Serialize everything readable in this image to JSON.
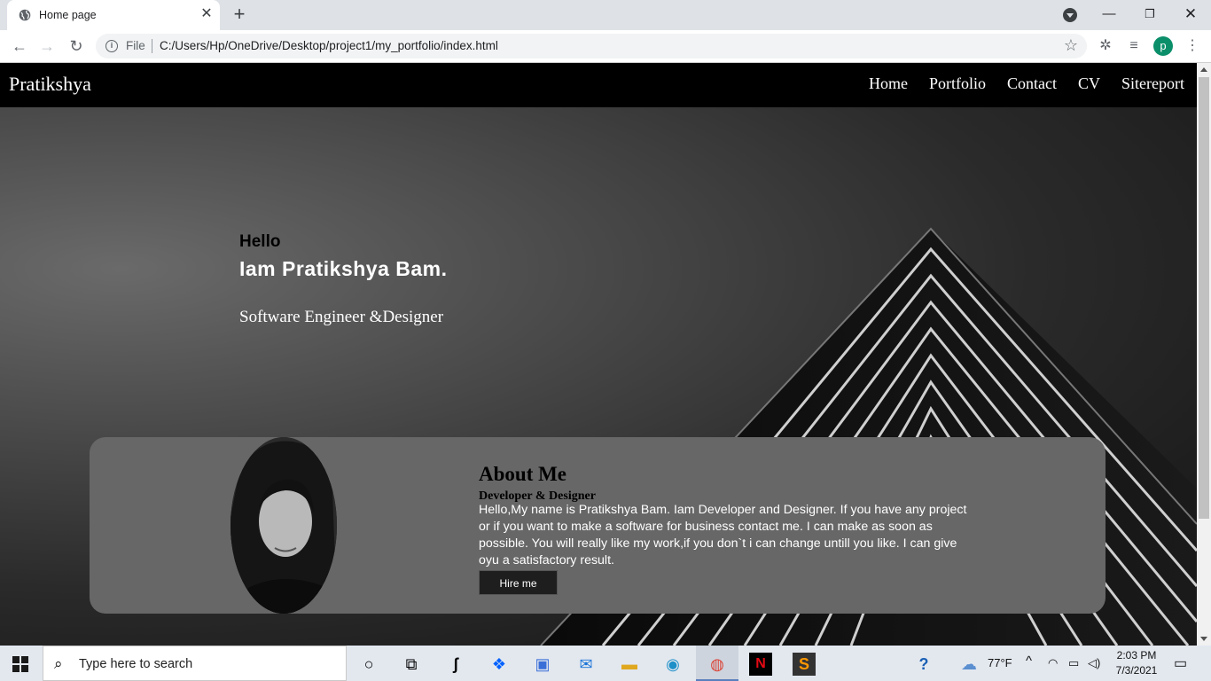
{
  "browser": {
    "tab_title": "Home page",
    "scheme_label": "File",
    "url": "C:/Users/Hp/OneDrive/Desktop/project1/my_portfolio/index.html",
    "profile_initial": "p"
  },
  "site": {
    "brand": "Pratikshya",
    "nav": [
      "Home",
      "Portfolio",
      "Contact",
      "CV",
      "Sitereport"
    ],
    "hero": {
      "greeting": "Hello",
      "name_line": "Iam Pratikshya Bam.",
      "role": "Software Engineer &Designer"
    },
    "about": {
      "title": "About Me",
      "subtitle": "Developer & Designer",
      "text": "Hello,My name is Pratikshya Bam. Iam Developer and Designer. If you have any project or if you want to make a software for business contact me. I can make as soon as possible. You will really like my work,if you don`t i can change untill you like. I can give oyu a satisfactory result.",
      "button": "Hire me"
    }
  },
  "taskbar": {
    "search_placeholder": "Type here to search",
    "temperature": "77°F",
    "time": "2:03 PM",
    "date": "7/3/2021",
    "colors": {
      "accent": "#5a7fbf"
    }
  }
}
